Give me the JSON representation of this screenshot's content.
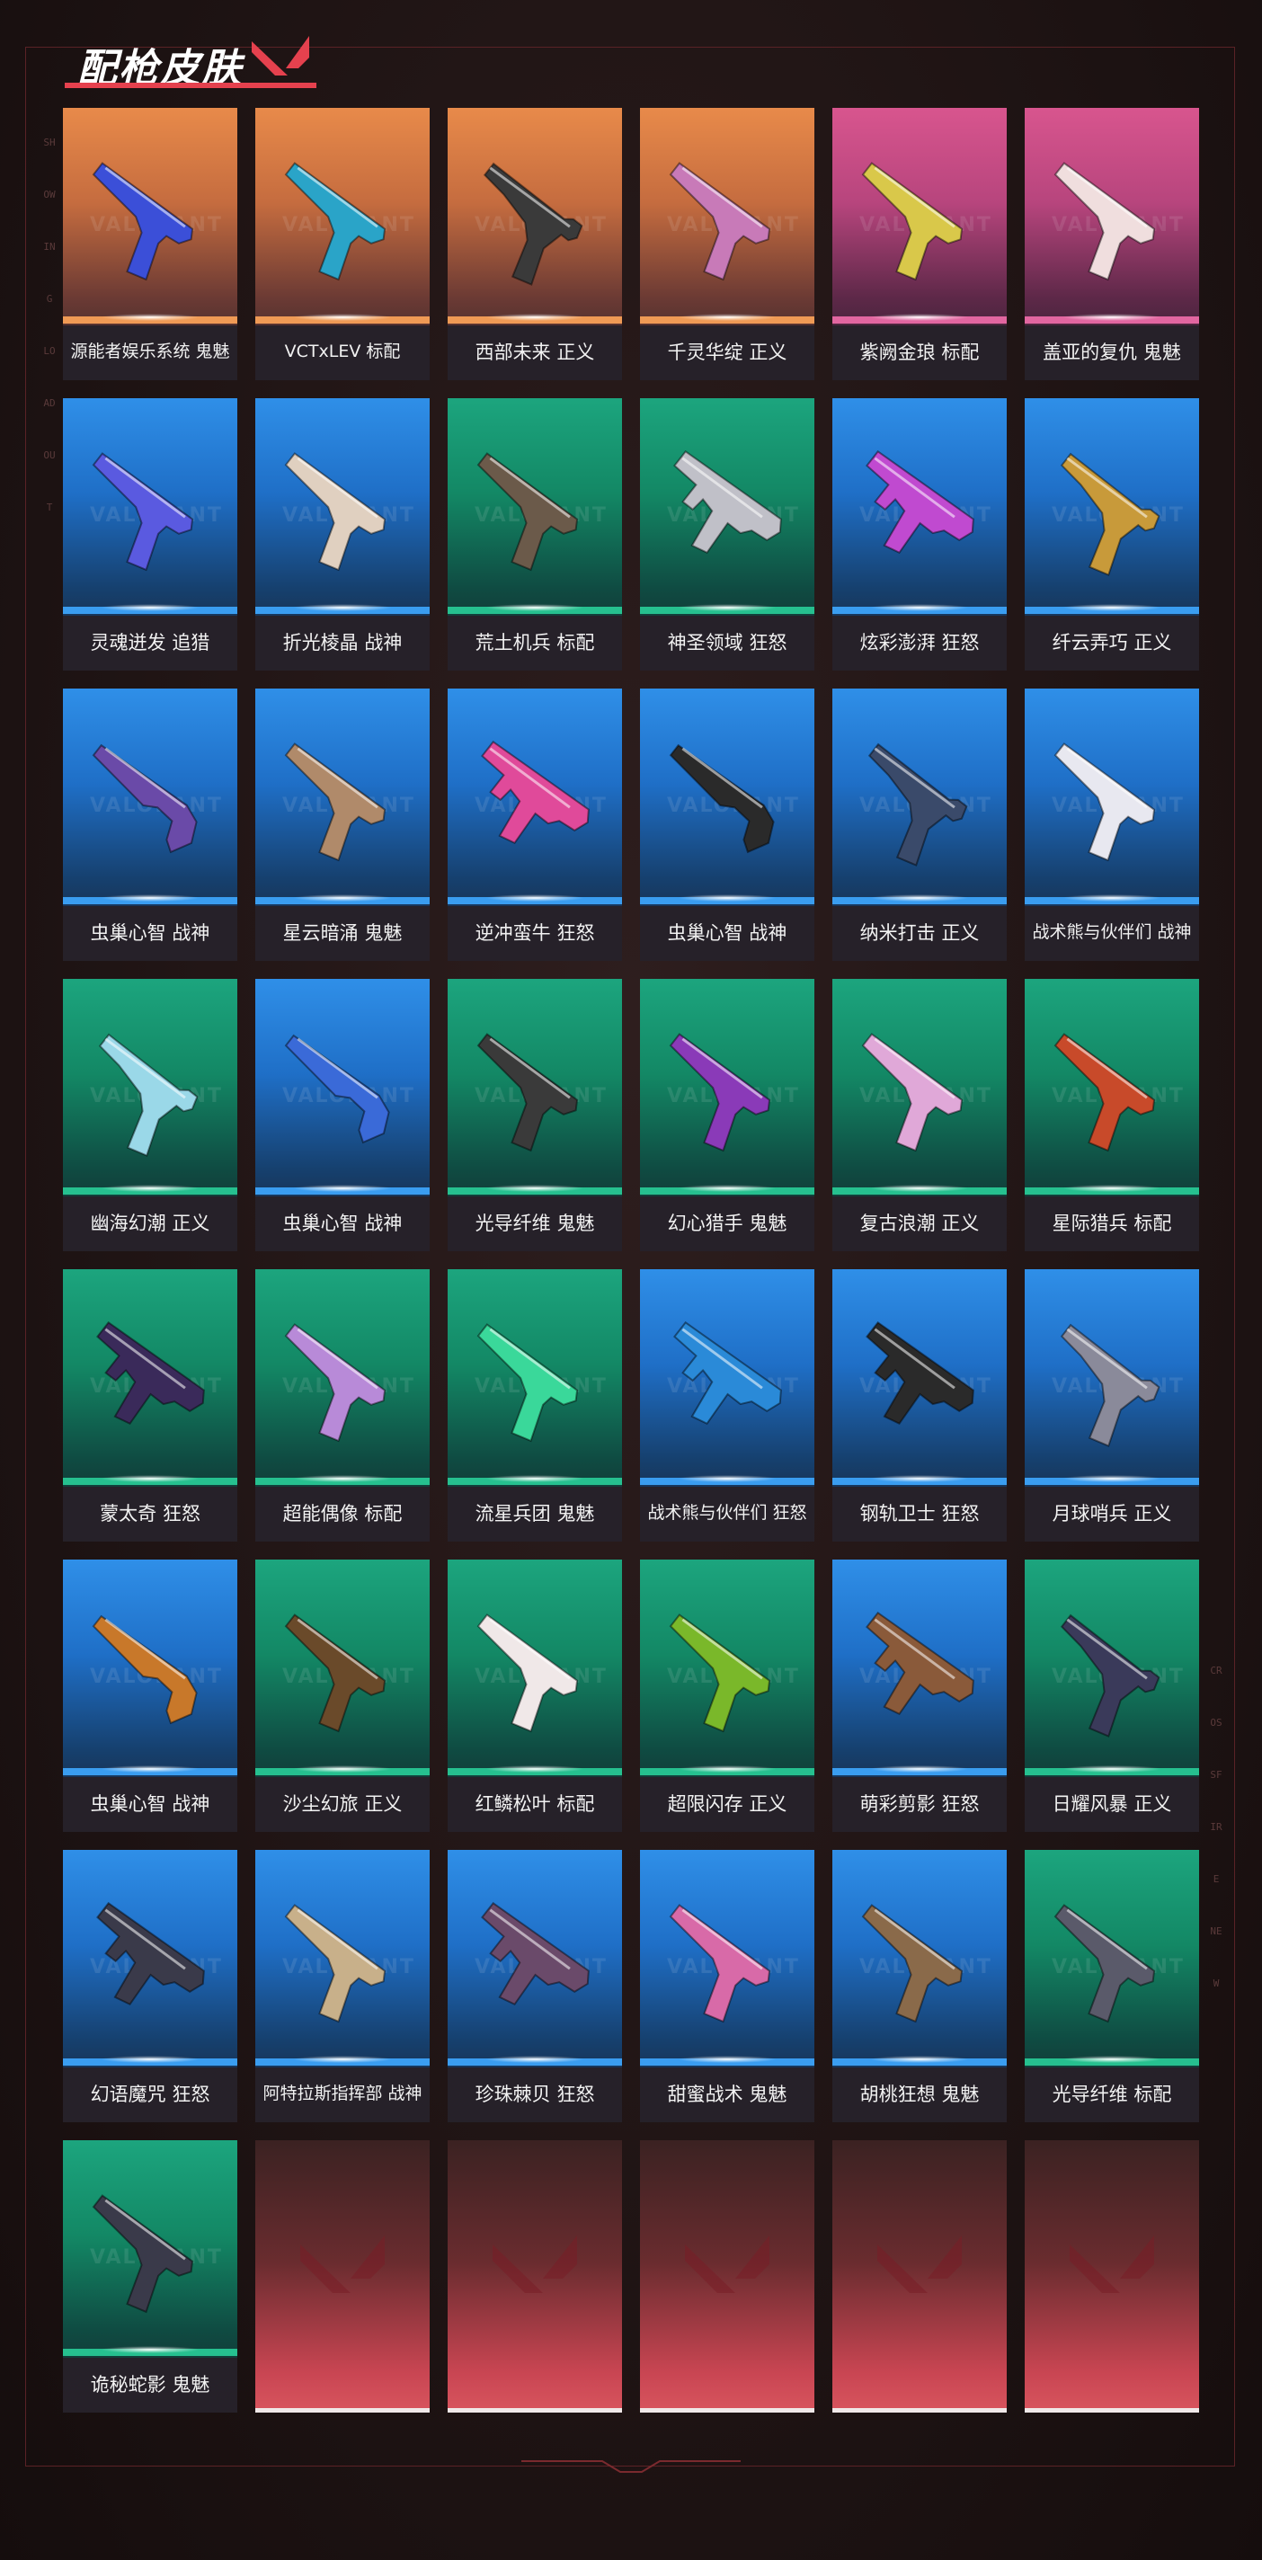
{
  "header": {
    "title": "配枪皮肤"
  },
  "colors": {
    "accent": "#e5414e",
    "orange": "#e88a4a",
    "pink": "#d8558e",
    "blue": "#2f8fe8",
    "green": "#1ca57e",
    "empty": "#d8555e"
  },
  "side_text": {
    "left": "SHOWING LOADOUT",
    "right": "CROSSFIRE NEW"
  },
  "watermark": "VALORANT",
  "skins": [
    {
      "name": "源能者娱乐系统 鬼魅",
      "bg": "orange",
      "icon": "pistol-icon",
      "accent": "#3b4fd8"
    },
    {
      "name": "VCTxLEV 标配",
      "bg": "orange",
      "icon": "pistol-icon",
      "accent": "#2aa4c8"
    },
    {
      "name": "西部未来 正义",
      "bg": "orange",
      "icon": "revolver-icon",
      "accent": "#3a3a3a"
    },
    {
      "name": "千灵华绽 正义",
      "bg": "orange",
      "icon": "pistol-icon",
      "accent": "#c87ab8"
    },
    {
      "name": "紫阙金琅 标配",
      "bg": "pink",
      "icon": "pistol-icon",
      "accent": "#d9c84a"
    },
    {
      "name": "盖亚的复仇 鬼魅",
      "bg": "pink",
      "icon": "pistol-icon",
      "accent": "#f0dede"
    },
    {
      "name": "灵魂迸发 追猎",
      "bg": "blue",
      "icon": "pistol-icon",
      "accent": "#5a5ae0"
    },
    {
      "name": "折光棱晶 战神",
      "bg": "blue",
      "icon": "pistol-icon",
      "accent": "#e0d0c0"
    },
    {
      "name": "荒土机兵 标配",
      "bg": "green",
      "icon": "pistol-icon",
      "accent": "#6b5a4a"
    },
    {
      "name": "神圣领域 狂怒",
      "bg": "green",
      "icon": "smg-icon",
      "accent": "#c0c0c8"
    },
    {
      "name": "炫彩澎湃 狂怒",
      "bg": "blue",
      "icon": "smg-icon",
      "accent": "#c04ad0"
    },
    {
      "name": "纤云弄巧 正义",
      "bg": "blue",
      "icon": "revolver-icon",
      "accent": "#c89a3a"
    },
    {
      "name": "虫巢心智 战神",
      "bg": "blue",
      "icon": "shotgun-icon",
      "accent": "#6a4aa8"
    },
    {
      "name": "星云暗涌 鬼魅",
      "bg": "blue",
      "icon": "pistol-icon",
      "accent": "#b08a6a"
    },
    {
      "name": "逆冲蛮牛 狂怒",
      "bg": "blue",
      "icon": "smg-icon",
      "accent": "#e04a9a"
    },
    {
      "name": "虫巢心智 战神",
      "bg": "blue",
      "icon": "shotgun-icon",
      "accent": "#2a2a2a"
    },
    {
      "name": "纳米打击 正义",
      "bg": "blue",
      "icon": "revolver-icon",
      "accent": "#3a4a6a"
    },
    {
      "name": "战术熊与伙伴们 战神",
      "bg": "blue",
      "icon": "pistol-icon",
      "accent": "#e8e8f0"
    },
    {
      "name": "幽海幻潮 正义",
      "bg": "green",
      "icon": "revolver-icon",
      "accent": "#9ad8e8"
    },
    {
      "name": "虫巢心智 战神",
      "bg": "blue",
      "icon": "shotgun-icon",
      "accent": "#3a6ad8"
    },
    {
      "name": "光导纤维 鬼魅",
      "bg": "green",
      "icon": "pistol-icon",
      "accent": "#3a3a3a"
    },
    {
      "name": "幻心猎手 鬼魅",
      "bg": "green",
      "icon": "pistol-icon",
      "accent": "#8a3ab8"
    },
    {
      "name": "复古浪潮 正义",
      "bg": "green",
      "icon": "pistol-icon",
      "accent": "#e0a8d8"
    },
    {
      "name": "星际猎兵 标配",
      "bg": "green",
      "icon": "pistol-icon",
      "accent": "#c84a2a"
    },
    {
      "name": "蒙太奇 狂怒",
      "bg": "green",
      "icon": "smg-icon",
      "accent": "#3a2a5a"
    },
    {
      "name": "超能偶像 标配",
      "bg": "green",
      "icon": "pistol-icon",
      "accent": "#b88ad8"
    },
    {
      "name": "流星兵团 鬼魅",
      "bg": "green",
      "icon": "pistol-icon",
      "accent": "#3ad89a"
    },
    {
      "name": "战术熊与伙伴们 狂怒",
      "bg": "blue",
      "icon": "smg-icon",
      "accent": "#2a8ad8"
    },
    {
      "name": "钢轨卫士 狂怒",
      "bg": "blue",
      "icon": "smg-icon",
      "accent": "#2a2a2a"
    },
    {
      "name": "月球哨兵 正义",
      "bg": "blue",
      "icon": "revolver-icon",
      "accent": "#8a8a9a"
    },
    {
      "name": "虫巢心智 战神",
      "bg": "blue",
      "icon": "shotgun-icon",
      "accent": "#c8782a"
    },
    {
      "name": "沙尘幻旅 正义",
      "bg": "green",
      "icon": "pistol-icon",
      "accent": "#6a4a2a"
    },
    {
      "name": "红鳞松叶 标配",
      "bg": "green",
      "icon": "pistol-icon",
      "accent": "#f0e8e8"
    },
    {
      "name": "超限闪存 正义",
      "bg": "green",
      "icon": "pistol-icon",
      "accent": "#7ab82a"
    },
    {
      "name": "萌彩剪影 狂怒",
      "bg": "blue",
      "icon": "smg-icon",
      "accent": "#8a5a3a"
    },
    {
      "name": "日耀风暴 正义",
      "bg": "green",
      "icon": "revolver-icon",
      "accent": "#3a3a5a"
    },
    {
      "name": "幻语魔咒 狂怒",
      "bg": "blue",
      "icon": "smg-icon",
      "accent": "#3a3a4a"
    },
    {
      "name": "阿特拉斯指挥部 战神",
      "bg": "blue",
      "icon": "pistol-icon",
      "accent": "#c8b08a"
    },
    {
      "name": "珍珠棘贝 狂怒",
      "bg": "blue",
      "icon": "smg-icon",
      "accent": "#6a4a6a"
    },
    {
      "name": "甜蜜战术 鬼魅",
      "bg": "blue",
      "icon": "pistol-icon",
      "accent": "#d86aa8"
    },
    {
      "name": "胡桃狂想 鬼魅",
      "bg": "blue",
      "icon": "pistol-icon",
      "accent": "#8a6a4a"
    },
    {
      "name": "光导纤维 标配",
      "bg": "green",
      "icon": "pistol-icon",
      "accent": "#5a5a6a"
    },
    {
      "name": "诡秘蛇影 鬼魅",
      "bg": "green",
      "icon": "pistol-icon",
      "accent": "#3a3a4a"
    },
    {
      "name": "",
      "bg": "empty",
      "icon": "valorant-logo-icon",
      "accent": ""
    },
    {
      "name": "",
      "bg": "empty",
      "icon": "valorant-logo-icon",
      "accent": ""
    },
    {
      "name": "",
      "bg": "empty",
      "icon": "valorant-logo-icon",
      "accent": ""
    },
    {
      "name": "",
      "bg": "empty",
      "icon": "valorant-logo-icon",
      "accent": ""
    },
    {
      "name": "",
      "bg": "empty",
      "icon": "valorant-logo-icon",
      "accent": ""
    }
  ]
}
